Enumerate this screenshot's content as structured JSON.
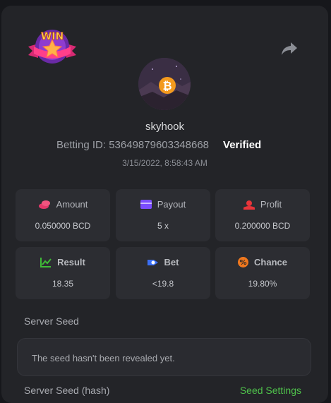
{
  "user": {
    "username": "skyhook",
    "betting_id_label": "Betting ID: 53649879603348668",
    "verified_label": "Verified",
    "date": "3/15/2022, 8:58:43 AM"
  },
  "badge": {
    "text": "WIN"
  },
  "stats": [
    {
      "label": "Amount",
      "value": "0.050000 BCD",
      "icon": "coin-icon",
      "color": "#e2386a"
    },
    {
      "label": "Payout",
      "value": "5 x",
      "icon": "wallet-icon",
      "color": "#7b4dff"
    },
    {
      "label": "Profit",
      "value": "0.200000 BCD",
      "icon": "profit-icon",
      "color": "#e8353a"
    },
    {
      "label": "Result",
      "value": "18.35",
      "icon": "chart-icon",
      "color": "#3fbb37"
    },
    {
      "label": "Bet",
      "value": "<19.8",
      "icon": "target-icon",
      "color": "#3b6ff5"
    },
    {
      "label": "Chance",
      "value": "19.80%",
      "icon": "percent-icon",
      "color": "#f0781e"
    }
  ],
  "server_seed": {
    "label": "Server Seed",
    "message": "The seed hasn't been revealed yet.",
    "hash_label": "Server Seed (hash)",
    "settings_link": "Seed Settings"
  }
}
